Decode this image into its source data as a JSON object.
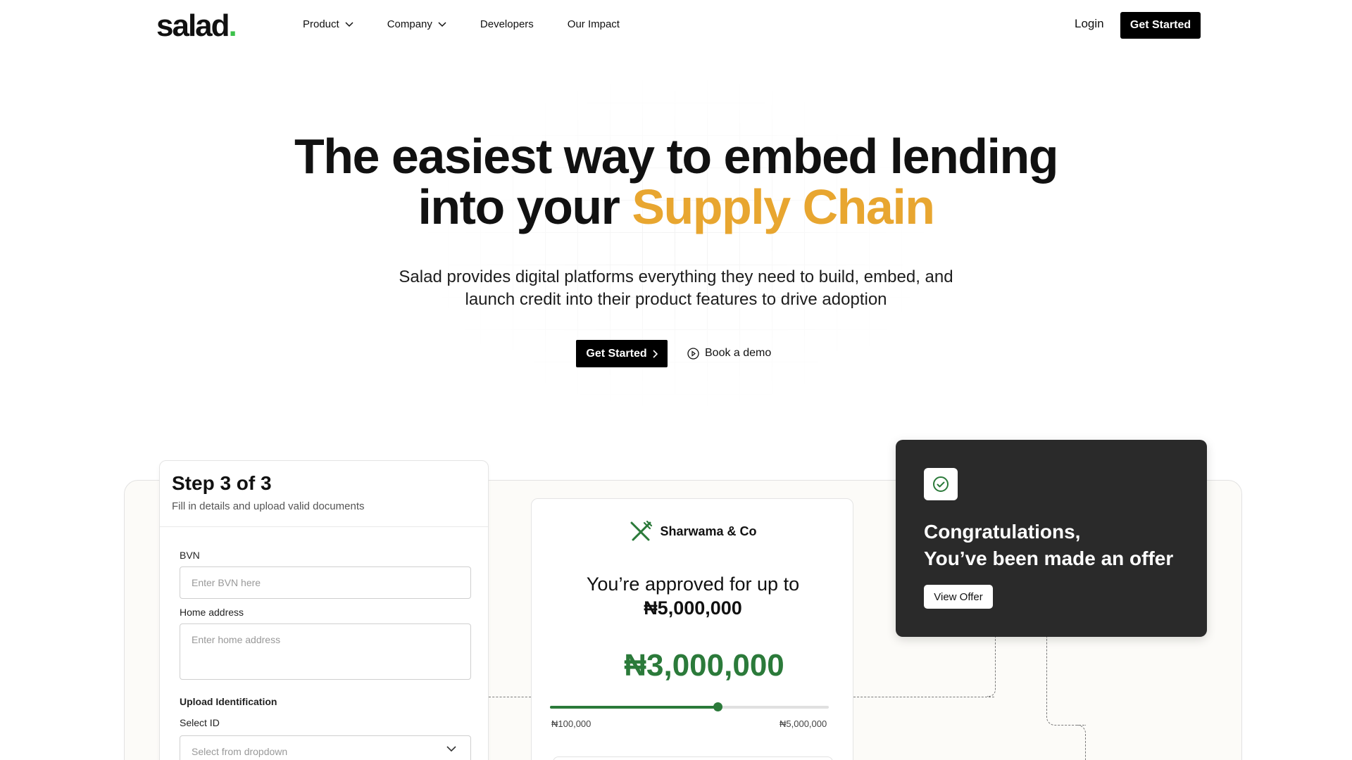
{
  "nav": {
    "logo": "salad",
    "logo_dot": ".",
    "links": [
      "Product",
      "Company",
      "Developers",
      "Our Impact"
    ],
    "login": "Login",
    "cta": "Get Started"
  },
  "hero": {
    "title_line1": "The easiest way to embed lending",
    "title_line2_plain": "into your ",
    "title_line2_accent": "Supply Chain",
    "subtitle_line1": "Salad provides digital platforms everything they need to build, embed, and",
    "subtitle_line2": "launch credit into their product features to drive adoption",
    "cta": "Get Started",
    "demo": "Book a demo"
  },
  "step_card": {
    "title": "Step 3 of 3",
    "description": "Fill in details and upload valid documents",
    "bvn_label": "BVN",
    "bvn_placeholder": "Enter BVN here",
    "address_label": "Home address",
    "address_placeholder": "Enter home address",
    "upload_label": "Upload Identification",
    "select_label": "Select ID",
    "select_placeholder": "Select from dropdown"
  },
  "approval_card": {
    "merchant": "Sharwama & Co",
    "approved_text": "You’re approved for up to",
    "approved_amount": "₦5,000,000",
    "selected_amount": "₦3,000,000",
    "slider_min": "₦100,000",
    "slider_max": "₦5,000,000",
    "slider_value_fraction": 0.6
  },
  "offer_card": {
    "line1": "Congratulations,",
    "line2": "You’ve been made an offer",
    "button": "View Offer"
  },
  "colors": {
    "accent": "#e8a630",
    "brand_green": "#3cc14a",
    "money_green": "#2b7a3a",
    "dark_card": "#2a2a2a"
  }
}
